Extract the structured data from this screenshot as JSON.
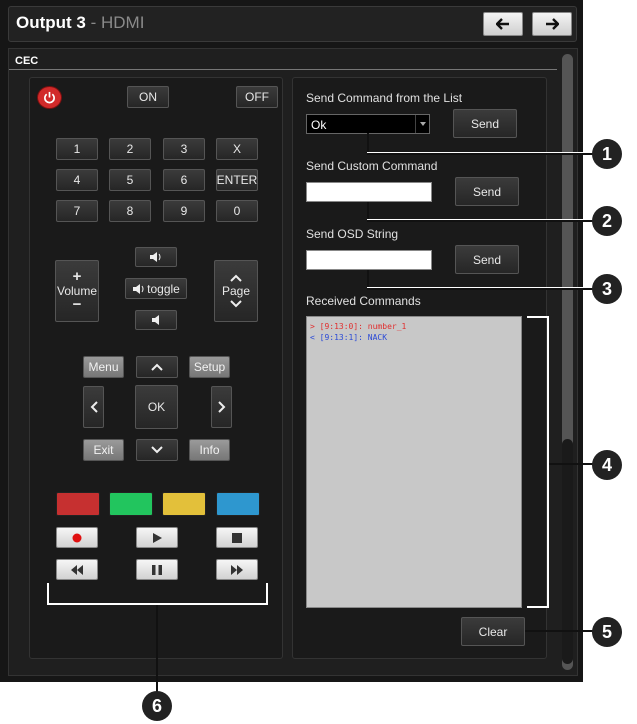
{
  "window": {
    "title": "Output 3",
    "title_separator": " - ",
    "title_sub": "HDMI"
  },
  "nav": {
    "prev_icon": "arrow-left-icon",
    "next_icon": "arrow-right-icon"
  },
  "section": {
    "label": "CEC"
  },
  "remote": {
    "power_icon": "power-icon",
    "on_label": "ON",
    "off_label": "OFF",
    "keypad": [
      "1",
      "2",
      "3",
      "X",
      "4",
      "5",
      "6",
      "ENTER",
      "7",
      "8",
      "9",
      "0"
    ],
    "volume_label": "Volume",
    "volume_plus": "+",
    "volume_minus": "−",
    "toggle_label": "toggle",
    "page_label": "Page",
    "menu_label": "Menu",
    "setup_label": "Setup",
    "ok_label": "OK",
    "exit_label": "Exit",
    "info_label": "Info",
    "color_keys": [
      "#c63030",
      "#22c55e",
      "#e3c03a",
      "#2e97cf"
    ]
  },
  "send": {
    "list_label": "Send Command from the List",
    "list_selected": "Ok",
    "list_send": "Send",
    "custom_label": "Send Custom Command",
    "custom_value": "",
    "custom_send": "Send",
    "osd_label": "Send OSD String",
    "osd_value": "",
    "osd_send": "Send"
  },
  "received": {
    "label": "Received Commands",
    "lines": [
      {
        "text": "> [9:13:0]: number_1",
        "color": "#e03030"
      },
      {
        "text": "< [9:13:1]: NACK",
        "color": "#2c4bd6"
      }
    ],
    "clear_label": "Clear"
  },
  "callouts": [
    "1",
    "2",
    "3",
    "4",
    "5",
    "6"
  ]
}
